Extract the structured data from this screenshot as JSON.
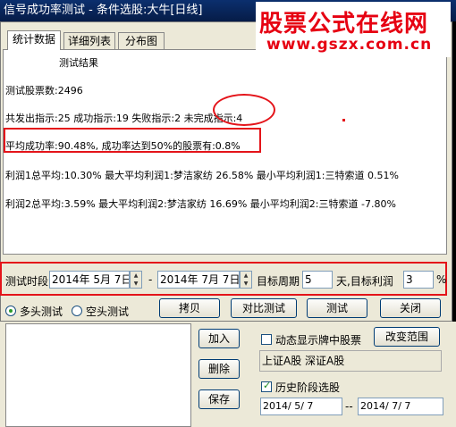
{
  "titlebar": {
    "title": "信号成功率测试 - 条件选股:大牛[日线]"
  },
  "watermark": {
    "line1": "股票公式在线网",
    "line2": "www.gszx.com.cn"
  },
  "tabs": [
    {
      "label": "统计数据",
      "active": true
    },
    {
      "label": "详细列表",
      "active": false
    },
    {
      "label": "分布图",
      "active": false
    }
  ],
  "result": {
    "heading": "测试结果",
    "stock_count": "测试股票数:2496",
    "signals": "共发出指示:25 成功指示:19 失败指示:2 未完成指示:4",
    "success_rate": "平均成功率:90.48%, 成功率达到50%的股票有:0.8%",
    "profit1": "利润1总平均:10.30% 最大平均利润1:梦洁家纺 26.58% 最小平均利润1:三特索道 0.51%",
    "profit2": "利润2总平均:3.59% 最大平均利润2:梦洁家纺 16.69% 最小平均利润2:三特索道 -7.80%"
  },
  "params": {
    "period_label": "测试时段",
    "start_date": "2014年  5月 7日",
    "dash": "-",
    "end_date": "2014年  7月  7日",
    "target_period_label": "目标周期",
    "target_period_value": "5",
    "days_label": "天,目标利润",
    "target_profit_value": "3",
    "percent": "%"
  },
  "mode": {
    "long_label": "多头测试",
    "short_label": "空头测试",
    "selected": "long"
  },
  "buttons": {
    "copy": "拷贝",
    "compare": "对比测试",
    "test": "测试",
    "close": "关闭"
  },
  "lower": {
    "add": "加入",
    "delete": "删除",
    "save": "保存",
    "dynamic_label": "动态显示牌中股票",
    "change_range": "改变范围",
    "markets": "上证A股 深证A股",
    "history_label": "历史阶段选股",
    "hist_start": "2014/ 5/ 7",
    "hist_sep": "--",
    "hist_end": "2014/ 7/ 7"
  },
  "colors": {
    "annotation": "#e4141a",
    "watermark": "#e60012",
    "titlebar": "#0b2f6e"
  }
}
